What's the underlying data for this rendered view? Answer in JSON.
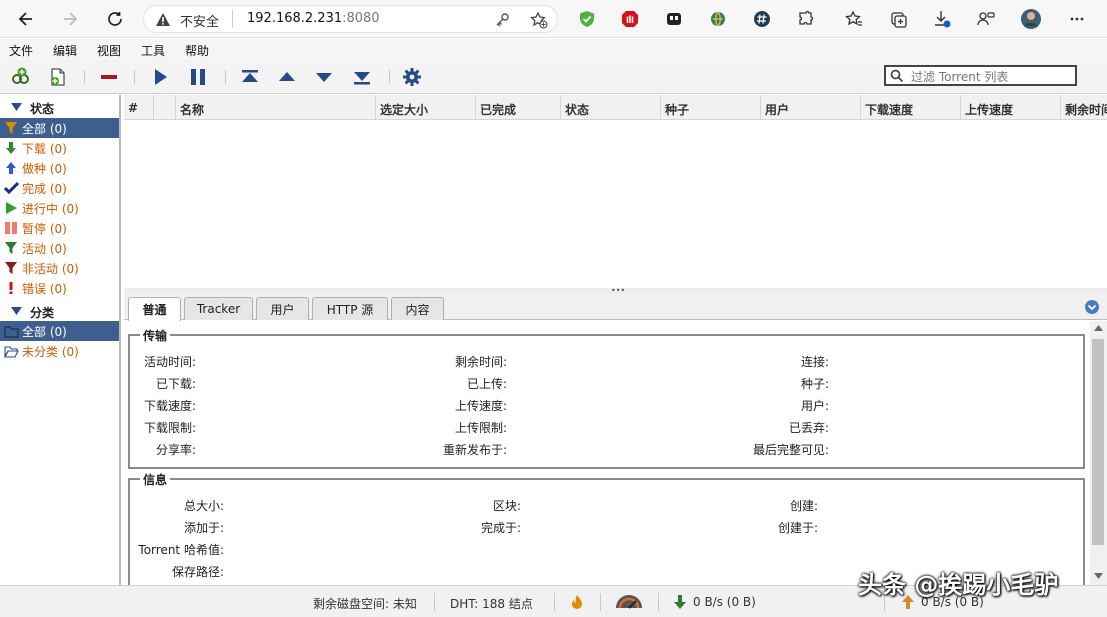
{
  "browser": {
    "security_text": "不安全",
    "url_host": "192.168.2.231",
    "url_port": ":8080"
  },
  "menu": [
    "文件",
    "编辑",
    "视图",
    "工具",
    "帮助"
  ],
  "filter": {
    "placeholder": "过滤 Torrent 列表"
  },
  "sidebar": {
    "status_header": "状态",
    "status_items": [
      {
        "label": "全部 (0)",
        "icon": "funnel-icon",
        "color": "#e08a00"
      },
      {
        "label": "下载 (0)",
        "icon": "download-arrow-icon",
        "color": "#2e8b2e"
      },
      {
        "label": "做种 (0)",
        "icon": "upload-arrow-icon",
        "color": "#2a5cd6"
      },
      {
        "label": "完成 (0)",
        "icon": "checkmark-icon",
        "color": "#1b2a8c"
      },
      {
        "label": "进行中 (0)",
        "icon": "play-icon",
        "color": "#2e9e2e"
      },
      {
        "label": "暂停 (0)",
        "icon": "pause-icon",
        "color": "#f07c6c"
      },
      {
        "label": "活动 (0)",
        "icon": "funnel-green-icon",
        "color": "#2e7a2e"
      },
      {
        "label": "非活动 (0)",
        "icon": "funnel-red-icon",
        "color": "#8b1a1a"
      },
      {
        "label": "错误 (0)",
        "icon": "exclamation-icon",
        "color": "#d01010"
      }
    ],
    "category_header": "分类",
    "category_items": [
      {
        "label": "全部 (0)",
        "icon": "folder-icon"
      },
      {
        "label": "未分类 (0)",
        "icon": "folder-open-icon"
      }
    ]
  },
  "table": {
    "columns": [
      "#",
      "",
      "名称",
      "选定大小",
      "已完成",
      "状态",
      "种子",
      "用户",
      "下载速度",
      "上传速度",
      "剩余时间"
    ]
  },
  "tabs": [
    "普通",
    "Tracker",
    "用户",
    "HTTP 源",
    "内容"
  ],
  "transfer": {
    "title": "传输",
    "col1": [
      "活动时间:",
      "已下载:",
      "下载速度:",
      "下载限制:",
      "分享率:"
    ],
    "col2": [
      "剩余时间:",
      "已上传:",
      "上传速度:",
      "上传限制:",
      "重新发布于:"
    ],
    "col3": [
      "连接:",
      "种子:",
      "用户:",
      "已丢弃:",
      "最后完整可见:"
    ]
  },
  "info": {
    "title": "信息",
    "col1": [
      "总大小:",
      "添加于:",
      "Torrent 哈希值:",
      "保存路径:"
    ],
    "col2": [
      "区块:",
      "完成于:"
    ],
    "col3": [
      "创建:",
      "创建于:"
    ]
  },
  "status": {
    "disk": "剩余磁盘空间: 未知",
    "dht": "DHT: 188 结点",
    "down": "0 B/s (0 B)",
    "up": "0 B/s (0 B)"
  },
  "watermark": "头条 @挨踢小毛驴"
}
